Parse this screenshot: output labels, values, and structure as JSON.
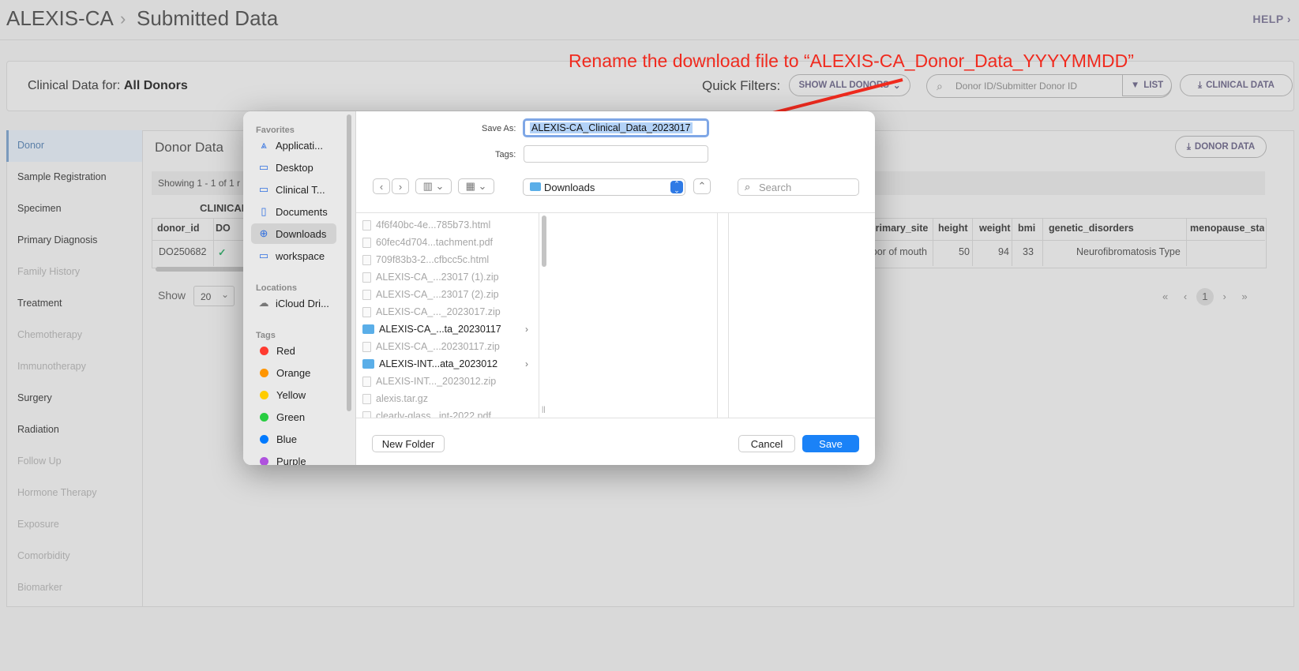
{
  "colors": {
    "accent": "#1a82f7",
    "annotation": "#f02a1e",
    "brand_text": "#6d6885"
  },
  "header": {
    "project": "ALEXIS-CA",
    "separator": "›",
    "page": "Submitted Data",
    "help": "HELP ›"
  },
  "filter_bar": {
    "clinical_for_label": "Clinical Data for:",
    "clinical_for_value": "All Donors",
    "quick_filters_label": "Quick Filters:",
    "quick_filter_value": "SHOW ALL DONORS",
    "search_placeholder": "Donor ID/Submitter Donor ID",
    "list_label": "LIST",
    "clinical_data_label": "CLINICAL DATA"
  },
  "sidebar": {
    "items": [
      {
        "label": "Donor",
        "active": true
      },
      {
        "label": "Sample Registration"
      },
      {
        "label": "Specimen"
      },
      {
        "label": "Primary Diagnosis"
      },
      {
        "label": "Family History",
        "dim": true
      },
      {
        "label": "Treatment"
      },
      {
        "label": "Chemotherapy",
        "dim": true
      },
      {
        "label": "Immunotherapy",
        "dim": true
      },
      {
        "label": "Surgery"
      },
      {
        "label": "Radiation"
      },
      {
        "label": "Follow Up",
        "dim": true
      },
      {
        "label": "Hormone Therapy",
        "dim": true
      },
      {
        "label": "Exposure",
        "dim": true
      },
      {
        "label": "Comorbidity",
        "dim": true
      },
      {
        "label": "Biomarker",
        "dim": true
      }
    ]
  },
  "main": {
    "title": "Donor Data",
    "donor_data_button": "DONOR DATA",
    "showing": "Showing 1 - 1 of 1 r",
    "clinical_header": "CLINICAL",
    "columns_left": [
      "donor_id",
      "DO"
    ],
    "columns_right": [
      "primary_site",
      "height",
      "weight",
      "bmi",
      "genetic_disorders",
      "menopause_stat"
    ],
    "row": {
      "donor_id": "DO250682",
      "check": "✓",
      "primary_site": "loor of mouth",
      "height": "50",
      "weight": "94",
      "bmi": "33",
      "genetic_disorders": "Neurofibromatosis Type",
      "menopause_stat": ""
    },
    "show_label": "Show",
    "page_size": "20",
    "pager": {
      "first": "«",
      "prev": "‹",
      "current": "1",
      "next": "›",
      "last": "»"
    }
  },
  "annotation": {
    "text": "Rename the download file to “ALEXIS-CA_Donor_Data_YYYYMMDD”"
  },
  "dialog": {
    "favorites_title": "Favorites",
    "favorites": [
      {
        "label": "Applicati...",
        "icon": "applications-icon"
      },
      {
        "label": "Desktop",
        "icon": "desktop-icon"
      },
      {
        "label": "Clinical T...",
        "icon": "folder-icon"
      },
      {
        "label": "Documents",
        "icon": "document-icon"
      },
      {
        "label": "Downloads",
        "icon": "download-icon",
        "selected": true
      },
      {
        "label": "workspace",
        "icon": "folder-icon"
      }
    ],
    "locations_title": "Locations",
    "locations": [
      {
        "label": "iCloud Dri...",
        "icon": "cloud-icon"
      }
    ],
    "tags_title": "Tags",
    "tags": [
      {
        "label": "Red",
        "color": "#ff3b30"
      },
      {
        "label": "Orange",
        "color": "#ff9500"
      },
      {
        "label": "Yellow",
        "color": "#ffcc00"
      },
      {
        "label": "Green",
        "color": "#28cd41"
      },
      {
        "label": "Blue",
        "color": "#007aff"
      },
      {
        "label": "Purple",
        "color": "#af52de"
      }
    ],
    "save_as_label": "Save As:",
    "save_as_value": "ALEXIS-CA_Clinical_Data_2023017",
    "tags_label": "Tags:",
    "tags_value": "",
    "location": "Downloads",
    "search_placeholder": "Search",
    "files": [
      {
        "name": "4f6f40bc-4e...785b73.html",
        "dir": false
      },
      {
        "name": "60fec4d704...tachment.pdf",
        "dir": false
      },
      {
        "name": "709f83b3-2...cfbcc5c.html",
        "dir": false
      },
      {
        "name": "ALEXIS-CA_...23017 (1).zip",
        "dir": false
      },
      {
        "name": "ALEXIS-CA_...23017 (2).zip",
        "dir": false
      },
      {
        "name": "ALEXIS-CA_..._2023017.zip",
        "dir": false
      },
      {
        "name": "ALEXIS-CA_...ta_20230117",
        "dir": true
      },
      {
        "name": "ALEXIS-CA_...20230117.zip",
        "dir": false
      },
      {
        "name": "ALEXIS-INT...ata_2023012",
        "dir": true
      },
      {
        "name": "ALEXIS-INT..._2023012.zip",
        "dir": false
      },
      {
        "name": "alexis.tar.gz",
        "dir": false
      },
      {
        "name": "clearly-glass...int-2022.pdf",
        "dir": false
      }
    ],
    "new_folder": "New Folder",
    "cancel": "Cancel",
    "save": "Save"
  }
}
